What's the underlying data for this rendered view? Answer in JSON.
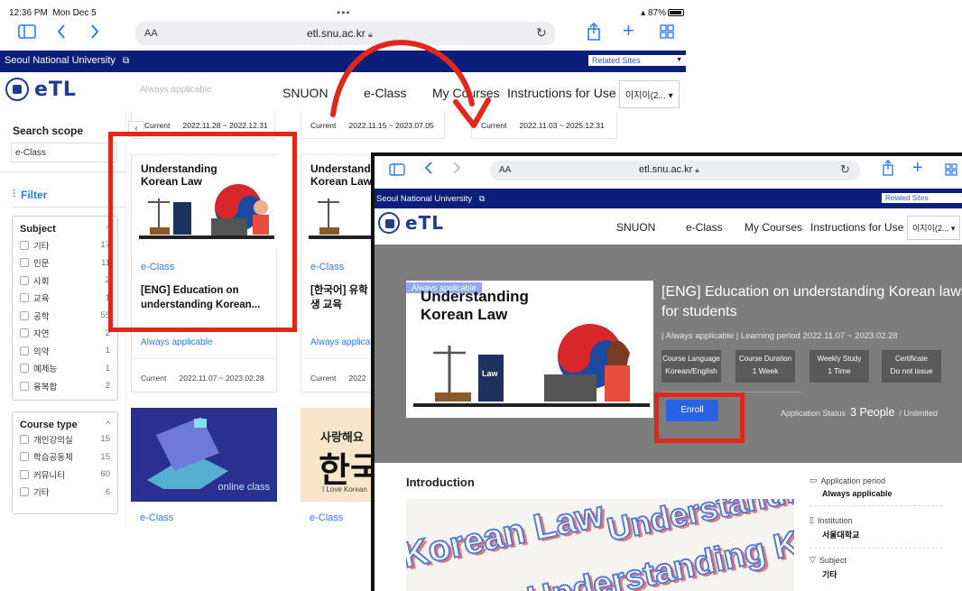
{
  "status_bar": {
    "time": "12:36 PM",
    "date": "Mon Dec 5",
    "battery": "87%"
  },
  "browser": {
    "aa": "AA",
    "url": "etl.snu.ac.kr"
  },
  "site": {
    "university": "Seoul National University",
    "related_sites": "Related Sites",
    "nav": [
      "SNUON",
      "e-Class",
      "My Courses",
      "Instructions for Use"
    ],
    "lang": "이지이(2...",
    "brand_color": "#0b1f7a",
    "accent_color": "#2f7cf6"
  },
  "back": {
    "top_labels": {
      "always_applicable": "Always applicable"
    },
    "current_rows": [
      {
        "label": "Current",
        "period": "2022.11.28 ~ 2022.12.31"
      },
      {
        "label": "Current",
        "period": "2022.11.15 ~ 2023.07.05"
      },
      {
        "label": "Current",
        "period": "2022.11.03 ~ 2025.12.31"
      }
    ],
    "sidebar": {
      "search_scope": "Search scope",
      "scope_value": "e-Class",
      "filter": "Filter",
      "subject": {
        "title": "Subject",
        "items": [
          {
            "label": "기타",
            "count": "17"
          },
          {
            "label": "인문",
            "count": "11"
          },
          {
            "label": "사회",
            "count": "2"
          },
          {
            "label": "교육",
            "count": "1"
          },
          {
            "label": "공학",
            "count": "55"
          },
          {
            "label": "자연",
            "count": "2"
          },
          {
            "label": "의약",
            "count": "1"
          },
          {
            "label": "예체능",
            "count": "1"
          },
          {
            "label": "융복합",
            "count": "2"
          }
        ]
      },
      "course_type": {
        "title": "Course type",
        "items": [
          {
            "label": "개인강의실",
            "count": "15"
          },
          {
            "label": "학습공동체",
            "count": "15"
          },
          {
            "label": "커뮤니티",
            "count": "60"
          },
          {
            "label": "기타",
            "count": "6"
          }
        ]
      }
    },
    "cards": [
      {
        "thumb_title": "Understanding Korean Law",
        "provider": "e-Class",
        "title": "[ENG] Education on understanding Korean...",
        "always": "Always applicable",
        "current": "Current",
        "period": "2022.11.07 ~ 2023.02.28"
      },
      {
        "thumb_title": "Understand Korean Law",
        "provider": "e-Class",
        "title": "[한국어] 유학생 교육",
        "always": "Always applica",
        "current": "Current",
        "period": "2022"
      }
    ],
    "row2": {
      "online_label": "online class",
      "korean_top": "사랑해요",
      "korean_big": "한국",
      "korean_sub": "I Love Korean",
      "provider1": "e-Class",
      "provider2": "e-Class"
    }
  },
  "front": {
    "badge": "Always applicable",
    "hero_img_title": "Understanding Korean Law",
    "law_book": "Law",
    "course_title": "[ENG] Education on understanding Korean laws for students",
    "meta": "| Always applicable | Learning period 2022.11.07 ~ 2023.02.28",
    "info_boxes": [
      {
        "label": "Course Language",
        "value": "Korean/English"
      },
      {
        "label": "Course Duration",
        "value": "1 Week"
      },
      {
        "label": "Weekly Study",
        "value": "1 Time"
      },
      {
        "label": "Certificate",
        "value": "Do not issue"
      }
    ],
    "enroll": "Enroll",
    "app_status_label": "Application Status",
    "app_status_count": "3 People",
    "app_status_limit": "/ Unlimited",
    "intro_title": "Introduction",
    "intro_words": [
      "Korean Law",
      "Understanding Korean Law",
      "Understanding Kor"
    ],
    "details": [
      {
        "label": "Application period",
        "value": "Always applicable"
      },
      {
        "label": "Institution",
        "value": "서울대학교"
      },
      {
        "label": "Subject",
        "value": "기타"
      }
    ]
  },
  "colors": {
    "highlight": "#e1261c",
    "enroll": "#2a62e6",
    "hero_bg": "#7d7d7d"
  }
}
